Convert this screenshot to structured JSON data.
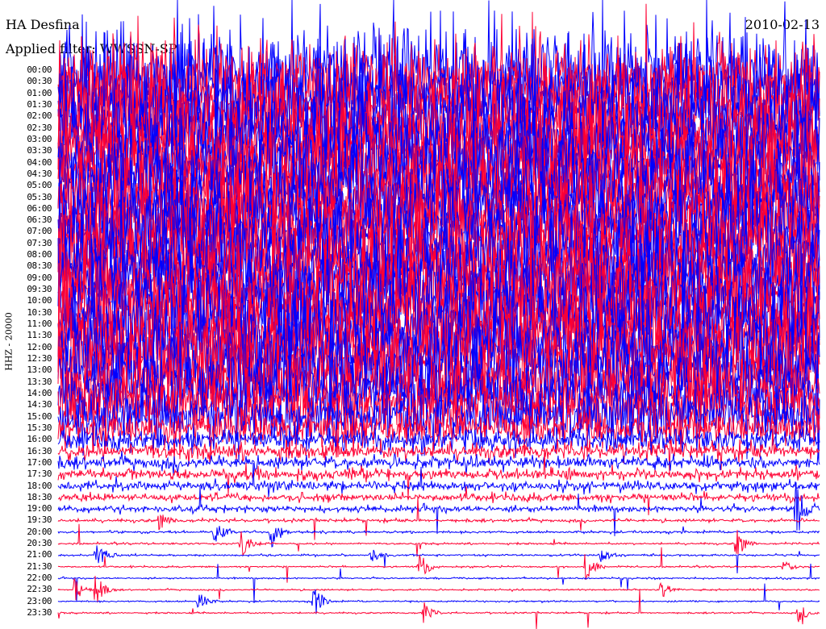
{
  "chart_data": {
    "type": "line",
    "title": "HA Desfina",
    "subtitle": "Applied filter: WWSSN-SP",
    "date": "2010-02-13",
    "ylabel": "HHZ - 20000",
    "row_labels": [
      "00:00",
      "00:30",
      "01:00",
      "01:30",
      "02:00",
      "02:30",
      "03:00",
      "03:30",
      "04:00",
      "04:30",
      "05:00",
      "05:30",
      "06:00",
      "06:30",
      "07:00",
      "07:30",
      "08:00",
      "08:30",
      "09:00",
      "09:30",
      "10:00",
      "10:30",
      "11:00",
      "11:30",
      "12:00",
      "12:30",
      "13:00",
      "13:30",
      "14:00",
      "14:30",
      "15:00",
      "15:30",
      "16:00",
      "16:30",
      "17:00",
      "17:30",
      "18:00",
      "18:30",
      "19:00",
      "19:30",
      "20:00",
      "20:30",
      "21:00",
      "21:30",
      "22:00",
      "22:30",
      "23:00",
      "23:30"
    ],
    "relative_amplitude": [
      60,
      60,
      60,
      60,
      60,
      60,
      60,
      60,
      60,
      60,
      60,
      60,
      60,
      60,
      60,
      60,
      60,
      60,
      60,
      60,
      60,
      60,
      60,
      60,
      60,
      60,
      55,
      50,
      45,
      40,
      35,
      25,
      14,
      10,
      8,
      7,
      6,
      5,
      4,
      2,
      1.5,
      1.2,
      1.2,
      1,
      1,
      1,
      1,
      1
    ],
    "series_colors": [
      "#0000ff",
      "#ff0033"
    ]
  }
}
